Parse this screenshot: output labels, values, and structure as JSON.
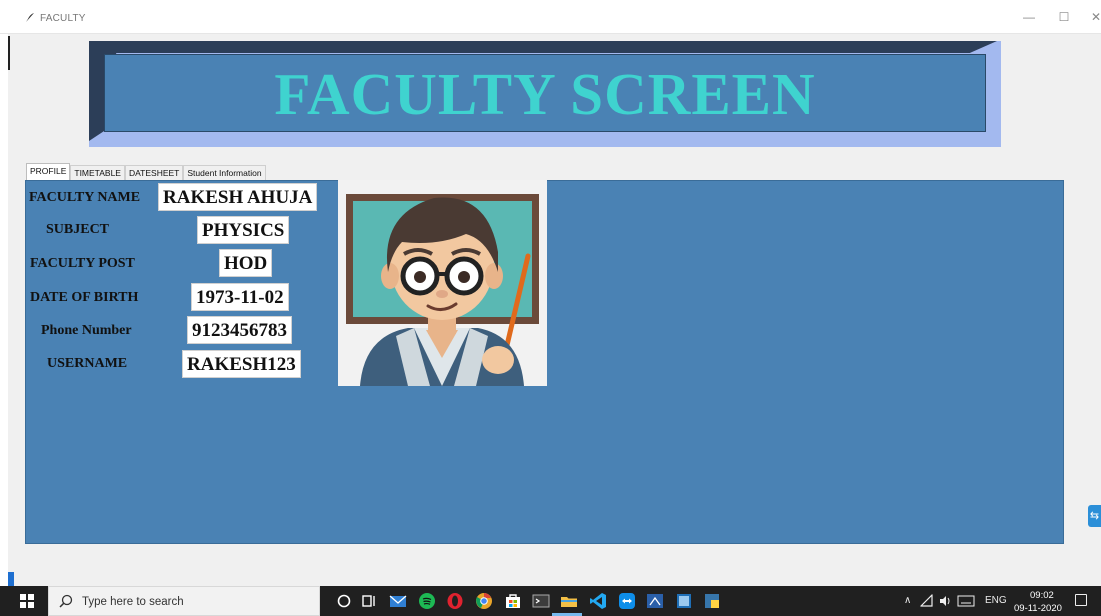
{
  "window": {
    "title": "FACULTY",
    "minimize_glyph": "—",
    "maximize_glyph": "☐",
    "close_glyph": "✕"
  },
  "banner": {
    "title": "FACULTY SCREEN"
  },
  "tabs": [
    {
      "label": "PROFILE",
      "active": true
    },
    {
      "label": "TIMETABLE",
      "active": false
    },
    {
      "label": "DATESHEET",
      "active": false
    },
    {
      "label": "Student Information",
      "active": false
    }
  ],
  "profile": {
    "faculty_name_label": "FACULTY NAME",
    "faculty_name_value": "RAKESH AHUJA",
    "subject_label": "SUBJECT",
    "subject_value": "PHYSICS",
    "post_label": "FACULTY POST",
    "post_value": "HOD",
    "dob_label": "DATE OF BIRTH",
    "dob_value": "1973-11-02",
    "phone_label": "Phone Number",
    "phone_value": "9123456783",
    "username_label": "USERNAME",
    "username_value": "RAKESH123"
  },
  "taskbar": {
    "search_placeholder": "Type here to search",
    "language": "ENG",
    "time": "09:02",
    "date": "09-11-2020"
  },
  "colors": {
    "panel": "#4a82b4",
    "banner_text": "#3fd3cf",
    "banner_border_light": "#a3b9ef",
    "banner_border_dark": "#2c3e58"
  }
}
